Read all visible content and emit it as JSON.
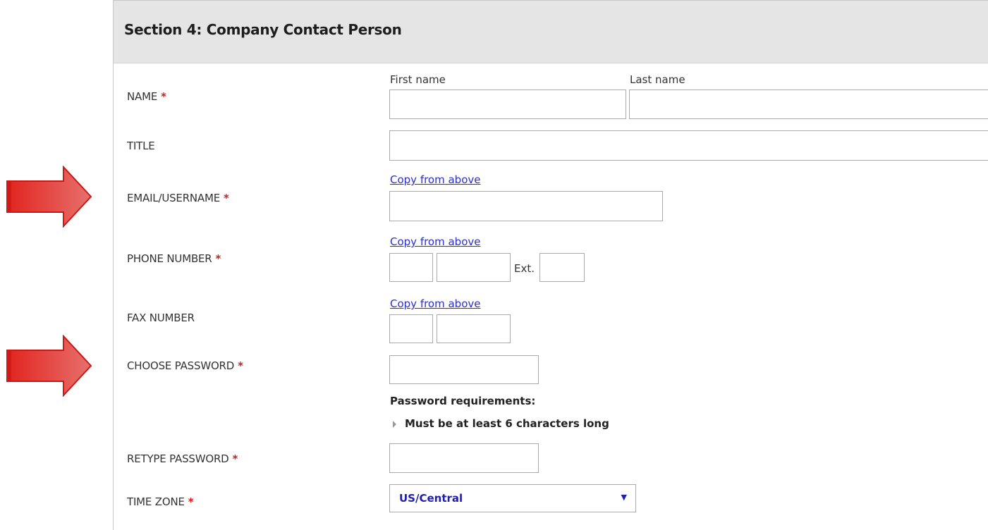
{
  "section": {
    "title": "Section 4: Company Contact Person"
  },
  "fields": {
    "name": {
      "label": "NAME",
      "first_label": "First name",
      "last_label": "Last name"
    },
    "title": {
      "label": "TITLE"
    },
    "email": {
      "label": "EMAIL/USERNAME",
      "copy_link": "Copy from above"
    },
    "phone": {
      "label": "PHONE NUMBER",
      "copy_link": "Copy from above",
      "ext_label": "Ext."
    },
    "fax": {
      "label": "FAX NUMBER",
      "copy_link": "Copy from above"
    },
    "password": {
      "label": "CHOOSE PASSWORD",
      "requirements_title": "Password requirements:",
      "requirements": [
        "Must be at least 6 characters long"
      ]
    },
    "retype": {
      "label": "RETYPE PASSWORD"
    },
    "timezone": {
      "label": "TIME ZONE",
      "value": "US/Central"
    }
  },
  "required_marker": "*",
  "colors": {
    "header_bg": "#e5e5e5",
    "link": "#2a2fd0",
    "required": "#d21d1d",
    "select_text": "#1f1fb0",
    "annotation_arrow": "#e0504e"
  },
  "icons": {
    "select_caret": "▼",
    "annotation_arrow": "red-arrow-icon"
  }
}
